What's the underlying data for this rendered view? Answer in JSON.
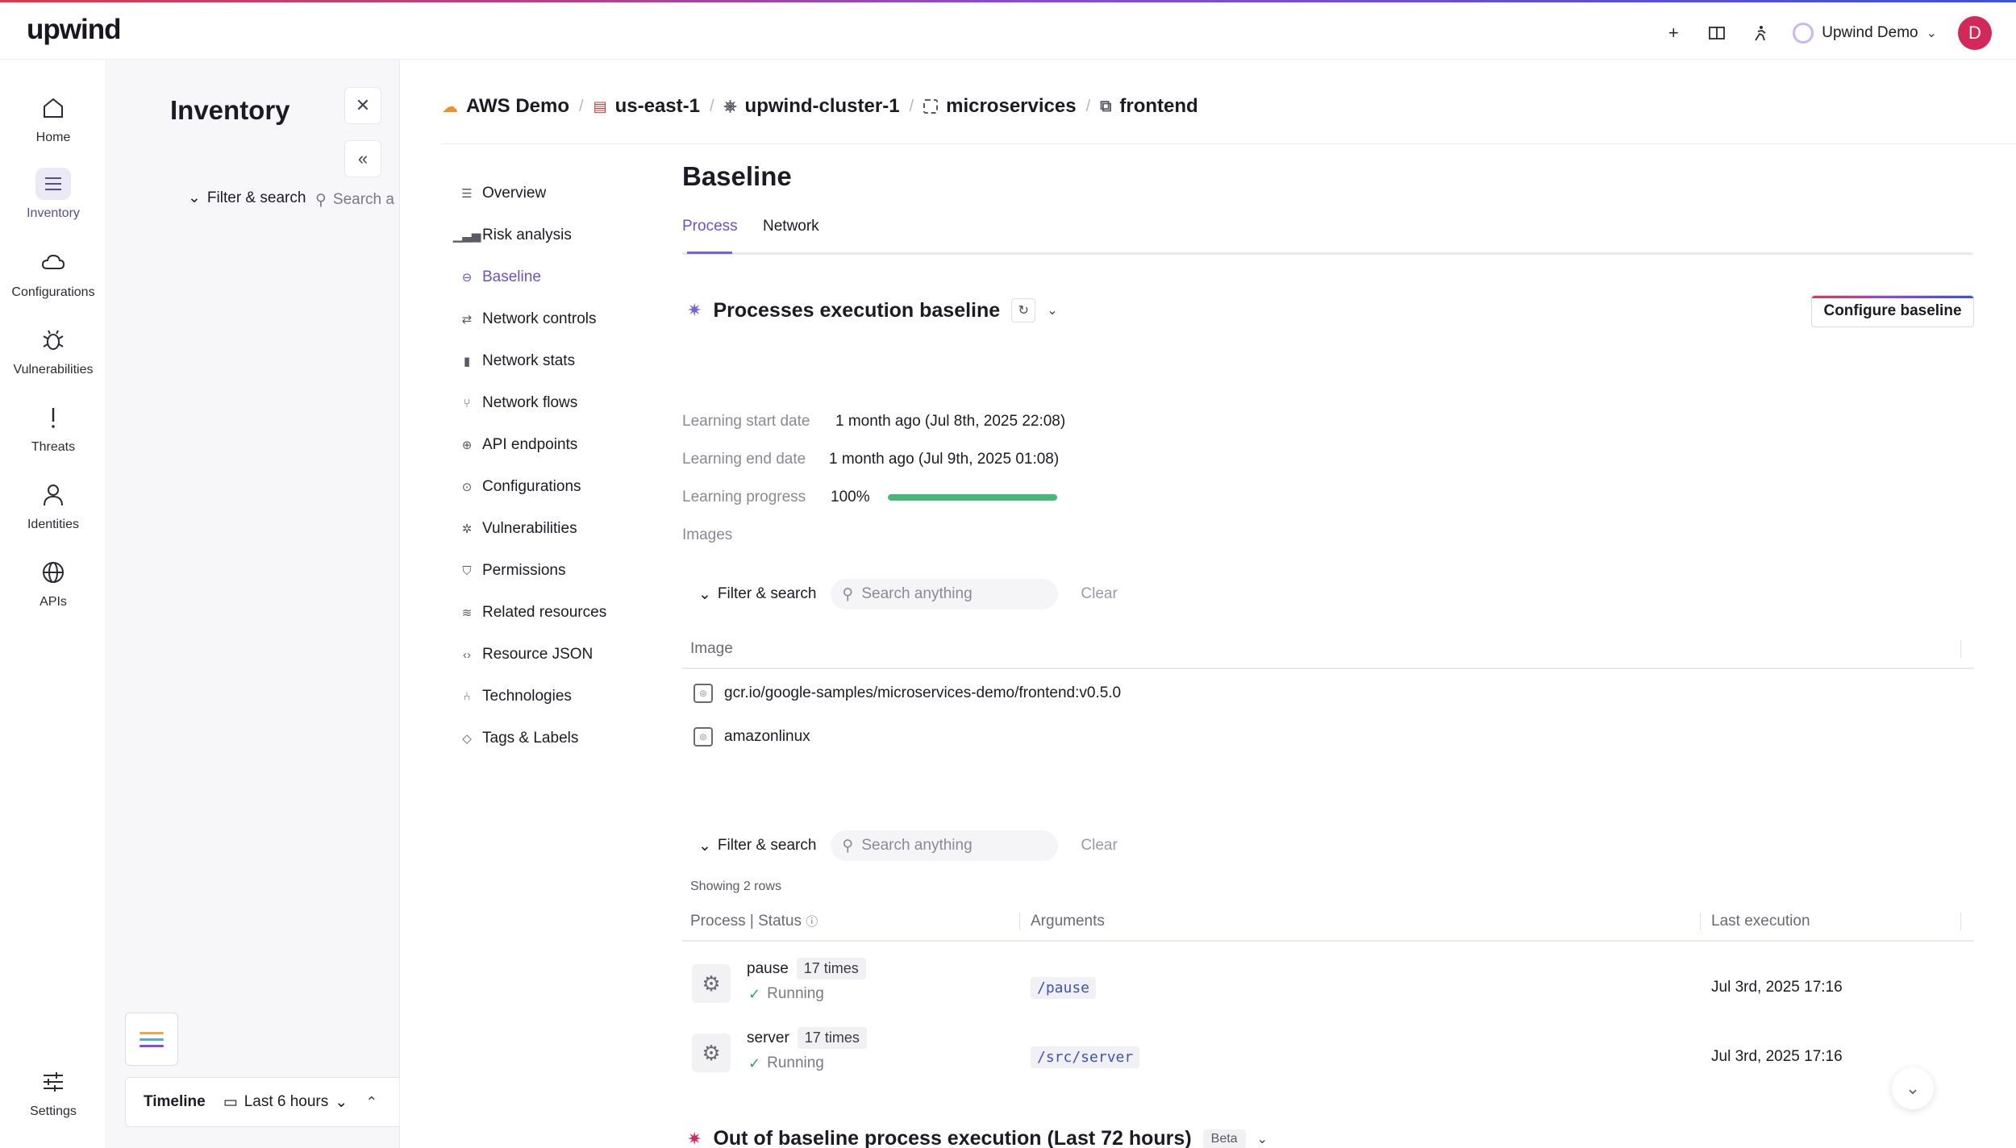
{
  "app": {
    "logo_text": "upwind"
  },
  "topbar": {
    "icons": [
      "plus-icon",
      "book-icon",
      "run-icon"
    ],
    "org_name": "Upwind Demo",
    "avatar_initial": "D"
  },
  "rail": {
    "items": [
      {
        "label": "Home",
        "icon": "home-icon"
      },
      {
        "label": "Inventory",
        "icon": "list-icon"
      },
      {
        "label": "Configurations",
        "icon": "cloud-icon"
      },
      {
        "label": "Vulnerabilities",
        "icon": "bug-icon"
      },
      {
        "label": "Threats",
        "icon": "exclamation-icon"
      },
      {
        "label": "Identities",
        "icon": "person-icon"
      },
      {
        "label": "APIs",
        "icon": "globe-icon"
      }
    ],
    "settings_label": "Settings"
  },
  "panel": {
    "title": "Inventory",
    "filter_label": "Filter & search",
    "search_placeholder": "Search a",
    "timeline_label": "Timeline",
    "timeline_range": "Last 6 hours"
  },
  "breadcrumb": [
    {
      "label": "AWS Demo",
      "icon": "cloud-icon"
    },
    {
      "label": "us-east-1",
      "icon": "flag-icon"
    },
    {
      "label": "upwind-cluster-1",
      "icon": "cluster-icon"
    },
    {
      "label": "microservices",
      "icon": "namespace-icon"
    },
    {
      "label": "frontend",
      "icon": "deployment-icon"
    }
  ],
  "subnav": [
    {
      "label": "Overview",
      "icon": "list-icon"
    },
    {
      "label": "Risk analysis",
      "icon": "signal-icon"
    },
    {
      "label": "Baseline",
      "icon": "baseline-icon",
      "active": true
    },
    {
      "label": "Network controls",
      "icon": "arrows-icon"
    },
    {
      "label": "Network stats",
      "icon": "bar-chart-icon"
    },
    {
      "label": "Network flows",
      "icon": "flow-icon"
    },
    {
      "label": "API endpoints",
      "icon": "globe-icon"
    },
    {
      "label": "Configurations",
      "icon": "config-icon"
    },
    {
      "label": "Vulnerabilities",
      "icon": "bug-icon"
    },
    {
      "label": "Permissions",
      "icon": "shield-icon"
    },
    {
      "label": "Related resources",
      "icon": "layers-icon"
    },
    {
      "label": "Resource JSON",
      "icon": "code-icon"
    },
    {
      "label": "Technologies",
      "icon": "branch-icon"
    },
    {
      "label": "Tags & Labels",
      "icon": "tag-icon"
    }
  ],
  "content": {
    "title": "Baseline",
    "tabs": [
      "Process",
      "Network"
    ],
    "section_title": "Processes execution baseline",
    "configure_label": "Configure baseline",
    "learning": {
      "start_label": "Learning start date",
      "start_value": "1 month ago (Jul 8th, 2025 22:08)",
      "end_label": "Learning end date",
      "end_value": "1 month ago (Jul 9th, 2025 01:08)",
      "progress_label": "Learning progress",
      "progress_value": "100%",
      "progress_fraction": 1.0
    },
    "images_label": "Images",
    "filter_label": "Filter & search",
    "search_placeholder": "Search anything",
    "clear_label": "Clear",
    "images_table": {
      "header": "Image",
      "rows": [
        "gcr.io/google-samples/microservices-demo/frontend:v0.5.0",
        "amazonlinux"
      ]
    },
    "showing_text": "Showing 2 rows",
    "process_table": {
      "headers": [
        "Process | Status",
        "Arguments",
        "Last execution"
      ],
      "rows": [
        {
          "name": "pause",
          "count": "17 times",
          "status": "Running",
          "args": "/pause",
          "last": "Jul 3rd, 2025 17:16"
        },
        {
          "name": "server",
          "count": "17 times",
          "status": "Running",
          "args": "/src/server",
          "last": "Jul 3rd, 2025 17:16"
        }
      ]
    },
    "oob_title": "Out of baseline process execution (Last 72 hours)",
    "oob_badge": "Beta"
  },
  "colors": {
    "accent": "#6b52c6",
    "progress": "#48b878",
    "danger": "#d3285a"
  }
}
